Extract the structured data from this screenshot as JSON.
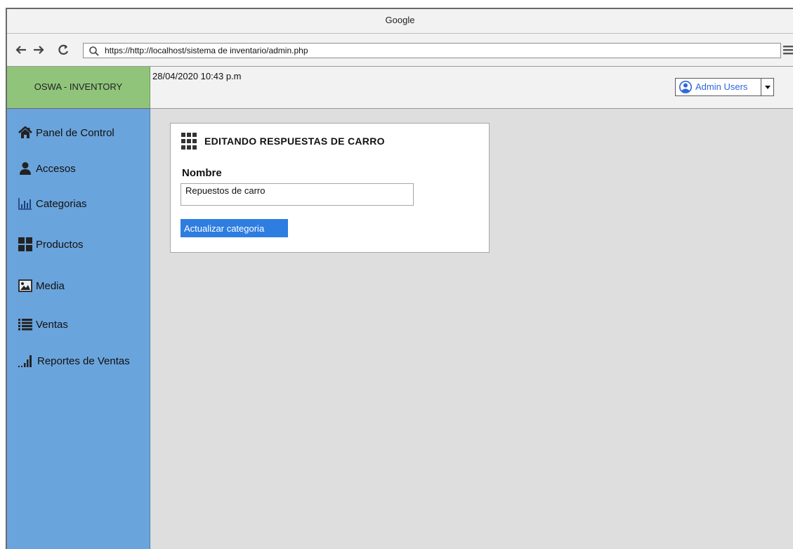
{
  "browser": {
    "title": "Google",
    "url": "https://http://localhost/sistema de inventario/admin.php"
  },
  "app": {
    "brand": "OSWA - INVENTORY",
    "datetime": "28/04/2020 10:43 p.m",
    "user": {
      "label": "Admin Users"
    }
  },
  "sidebar": {
    "items": [
      {
        "label": "Panel de Control",
        "icon": "home-icon"
      },
      {
        "label": "Accesos",
        "icon": "user-icon"
      },
      {
        "label": "Categorias",
        "icon": "bar-chart-icon"
      },
      {
        "label": "Productos",
        "icon": "grid-icon"
      },
      {
        "label": "Media",
        "icon": "image-icon"
      },
      {
        "label": "Ventas",
        "icon": "list-icon"
      },
      {
        "label": "Reportes de Ventas",
        "icon": "signal-bars-icon"
      }
    ]
  },
  "card": {
    "title": "EDITANDO RESPUESTAS DE CARRO",
    "field_label": "Nombre",
    "field_value": "Repuestos de carro",
    "button_label": "Actualizar categoria"
  },
  "colors": {
    "sidebar_bg": "#6aa4dc",
    "brand_bg": "#8fc47a",
    "button_bg": "#2e7de1",
    "user_link": "#2e68d8"
  }
}
